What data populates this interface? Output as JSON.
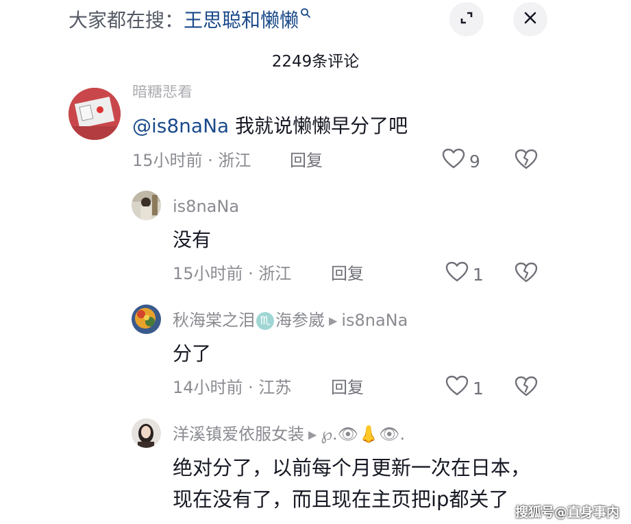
{
  "header": {
    "search_prefix": "大家都在搜：",
    "search_term": "王思聪和懒懒",
    "comment_count": "2249条评论"
  },
  "comments": [
    {
      "author": "暗糖悲着",
      "mention": "@is8naNa",
      "text": " 我就说懒懒早分了吧",
      "meta": "15小时前 · 浙江",
      "reply_label": "回复",
      "likes": "9"
    },
    {
      "author": "is8naNa",
      "text": "没有",
      "meta": "15小时前 · 浙江",
      "reply_label": "回复",
      "likes": "1"
    },
    {
      "author": "秋海棠之泪",
      "author_badge": "♏",
      "author_suffix": "海参崴",
      "reply_to": "is8naNa",
      "text": "分了",
      "meta": "14小时前 · 江苏",
      "reply_label": "回复",
      "likes": "1"
    },
    {
      "author": "洋溪镇爱依服女装",
      "reply_to": "℘.👁👃👁.",
      "text_line1": "绝对分了，以前每个月更新一次在日本，",
      "text_line2": "现在没有了，而且现在主页把ip都关了"
    }
  ],
  "watermark": "搜狐号@直身事内",
  "colors": {
    "link_blue": "#1a4a8a",
    "muted_gray": "#8a8b91",
    "text_dark": "#161823"
  },
  "icons": [
    "search-icon",
    "expand-icon",
    "close-icon",
    "heart-icon",
    "broken-heart-icon",
    "reply-arrow-icon"
  ]
}
